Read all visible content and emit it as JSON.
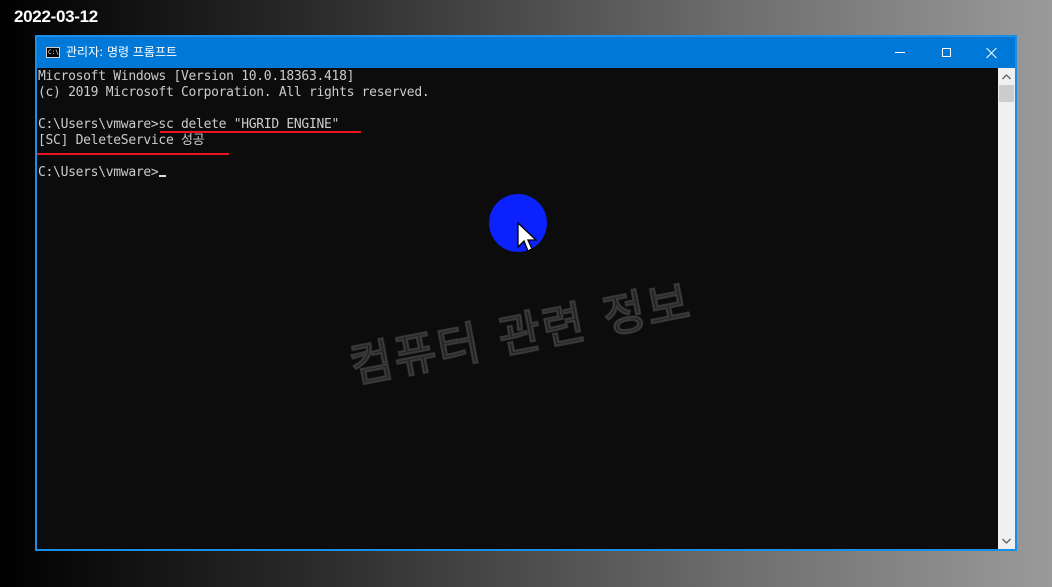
{
  "date_label": "2022-03-12",
  "window": {
    "title": "관리자: 명령 프롬프트",
    "icon": "cmd-icon",
    "icon_text": "C:\\",
    "controls": [
      "minimize-icon",
      "maximize-icon",
      "close-icon"
    ]
  },
  "console": {
    "lines": [
      "Microsoft Windows [Version 10.0.18363.418]",
      "(c) 2019 Microsoft Corporation. All rights reserved.",
      "",
      "C:\\Users\\vmware>sc delete \"HGRID ENGINE\"",
      "[SC] DeleteService 성공",
      "",
      "C:\\Users\\vmware>"
    ]
  },
  "watermark": "컴퓨터 관련 정보",
  "colors": {
    "titlebar": "#0078d7",
    "console_bg": "#0c0c0c",
    "console_text": "#cccccc",
    "annotation_underline": "#e8141e",
    "pointer_highlight": "#0b22ff"
  }
}
